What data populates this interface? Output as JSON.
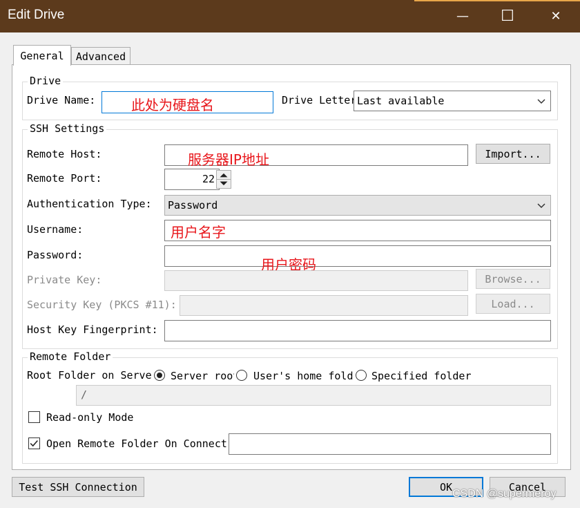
{
  "window": {
    "title": "Edit Drive",
    "minimize_glyph": "—",
    "maximize_glyph": "☐",
    "close_glyph": "✕"
  },
  "tabs": [
    {
      "label": "General",
      "active": true
    },
    {
      "label": "Advanced",
      "active": false
    }
  ],
  "drive": {
    "legend": "Drive",
    "name_label": "Drive Name:",
    "name_value": "",
    "name_annotation": "此处为硬盘名",
    "letter_label": "Drive Letter",
    "letter_value": "Last available"
  },
  "ssh": {
    "legend": "SSH Settings",
    "host_label": "Remote Host:",
    "host_value": "",
    "host_annotation": "服务器IP地址",
    "import_label": "Import...",
    "port_label": "Remote Port:",
    "port_value": "22",
    "auth_label": "Authentication Type:",
    "auth_value": "Password",
    "username_label": "Username:",
    "username_value": "",
    "username_annotation": "用户名字",
    "password_label": "Password:",
    "password_value": "",
    "password_annotation": "用户密码",
    "private_key_label": "Private Key:",
    "browse_label": "Browse...",
    "security_key_label": "Security Key (PKCS #11):",
    "load_label": "Load...",
    "fingerprint_label": "Host Key Fingerprint:",
    "fingerprint_value": ""
  },
  "remote_folder": {
    "legend": "Remote Folder",
    "root_label": "Root Folder on Server",
    "options": [
      {
        "label": "Server root",
        "selected": true
      },
      {
        "label": "User's home folder",
        "selected": false
      },
      {
        "label": "Specified folder",
        "selected": false
      }
    ],
    "path_value": "/",
    "readonly_label": "Read-only Mode",
    "readonly_checked": false,
    "open_label": "Open Remote Folder On Connect:",
    "open_checked": true,
    "open_value": ""
  },
  "footer": {
    "test_label": "Test SSH Connection",
    "ok_label": "OK",
    "cancel_label": "Cancel"
  },
  "watermark": "CSDN @supermeroy",
  "colors": {
    "titlebar": "#5c3a1c",
    "annotation": "#e8161b",
    "focus": "#0078d7"
  }
}
